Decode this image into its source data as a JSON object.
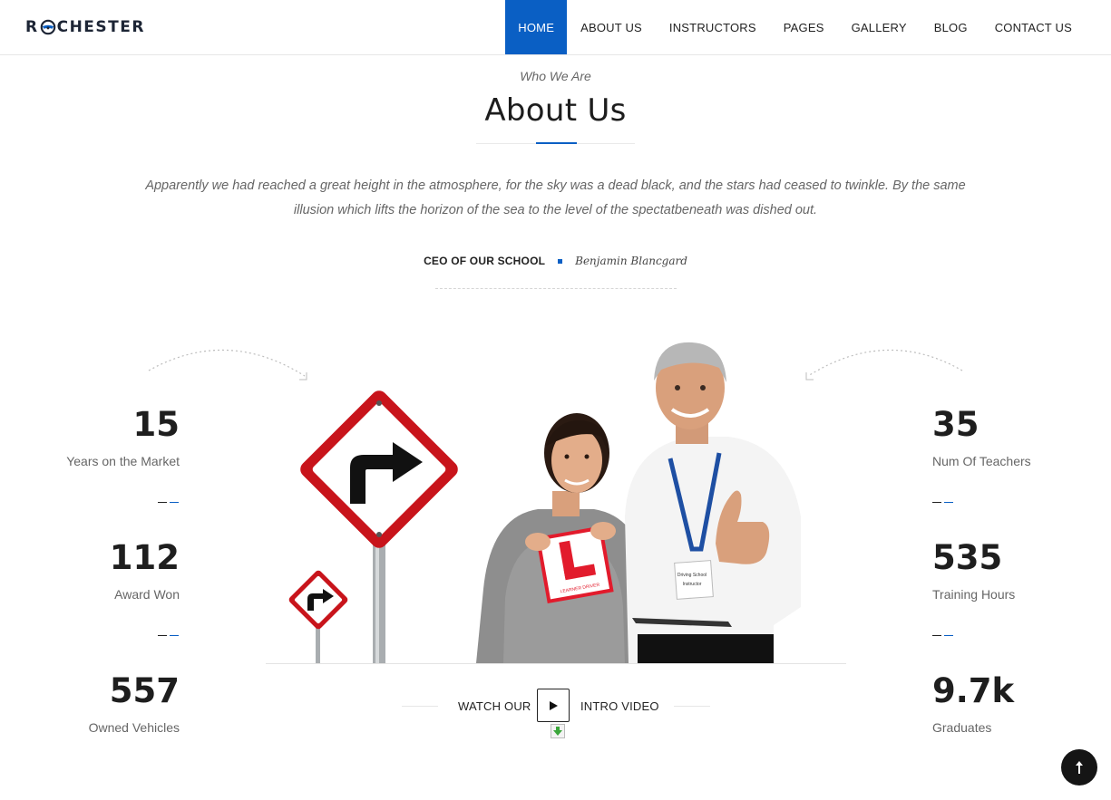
{
  "brand": {
    "name_left": "R",
    "name_right": "CHESTER",
    "logo_icon": "steering-wheel-icon",
    "accent": "#0a5fc4"
  },
  "nav": [
    {
      "label": "HOME",
      "active": true
    },
    {
      "label": "ABOUT US"
    },
    {
      "label": "INSTRUCTORS"
    },
    {
      "label": "PAGES"
    },
    {
      "label": "GALLERY"
    },
    {
      "label": "BLOG"
    },
    {
      "label": "CONTACT US"
    }
  ],
  "about": {
    "eyebrow": "Who We Are",
    "title": "About Us",
    "quote": "Apparently we had reached a great height in the atmosphere, for the sky was a dead black, and the stars had ceased to twinkle. By the same illusion which lifts the horizon of the sea to the level of the spectatbeneath was dished out.",
    "role": "CEO OF OUR SCHOOL",
    "signature": "Benjamin Blancgard"
  },
  "stats_left": [
    {
      "value": "15",
      "label": "Years on the Market"
    },
    {
      "value": "112",
      "label": "Award Won"
    },
    {
      "value": "557",
      "label": "Owned Vehicles"
    }
  ],
  "stats_right": [
    {
      "value": "35",
      "label": "Num Of Teachers"
    },
    {
      "value": "535",
      "label": "Training Hours"
    },
    {
      "value": "9.7k",
      "label": "Graduates"
    }
  ],
  "video": {
    "before": "WATCH OUR",
    "after": "INTRO VIDEO",
    "icon": "play-icon"
  },
  "hero_image": {
    "sign_text": "LEARNER DRIVER",
    "badge_text": "Driving School",
    "tag_text": "Instructor"
  },
  "back_to_top_icon": "arrow-up-icon"
}
